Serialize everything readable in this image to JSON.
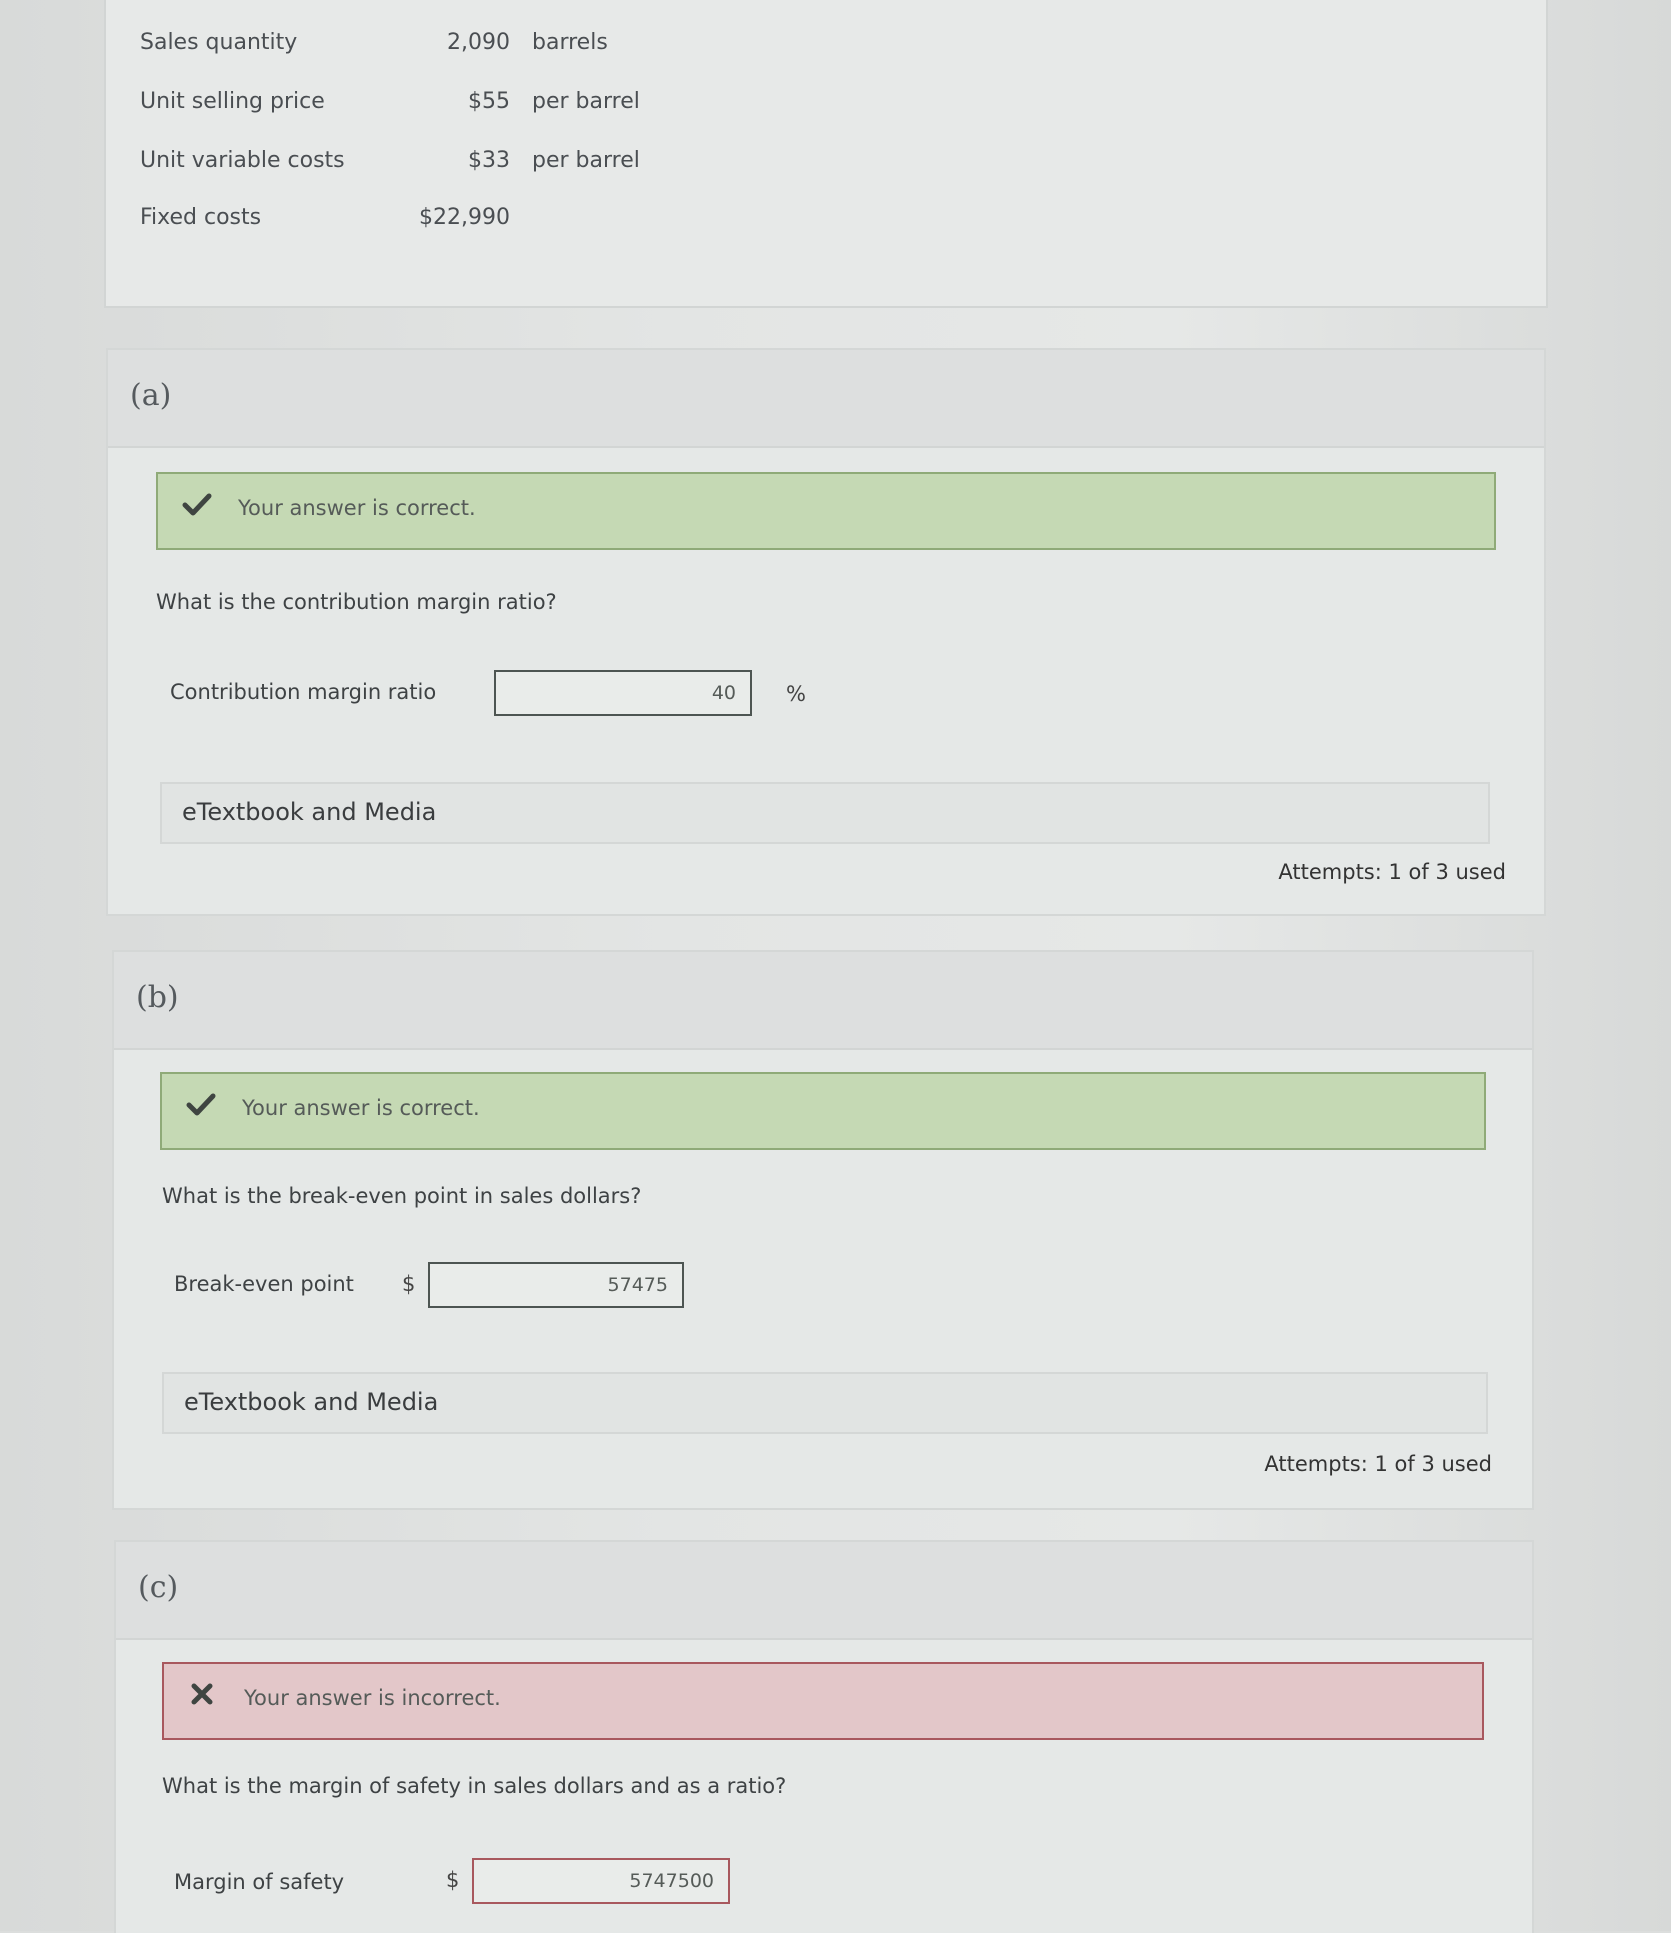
{
  "given": {
    "rows": [
      {
        "label": "Sales quantity",
        "value": "2,090",
        "unit": "barrels"
      },
      {
        "label": "Unit selling price",
        "value": "$55",
        "unit": "per barrel"
      },
      {
        "label": "Unit variable costs",
        "value": "$33",
        "unit": "per barrel"
      },
      {
        "label": "Fixed costs",
        "value": "$22,990",
        "unit": ""
      }
    ]
  },
  "part_a": {
    "letter": "(a)",
    "banner": "Your answer is correct.",
    "question": "What is the contribution margin ratio?",
    "field_label": "Contribution margin ratio",
    "value": "40",
    "suffix": "%",
    "media": "eTextbook and Media",
    "attempts": "Attempts: 1 of 3 used"
  },
  "part_b": {
    "letter": "(b)",
    "banner": "Your answer is correct.",
    "question": "What is the break-even point in sales dollars?",
    "field_label": "Break-even point",
    "currency": "$",
    "value": "57475",
    "media": "eTextbook and Media",
    "attempts": "Attempts: 1 of 3 used"
  },
  "part_c": {
    "letter": "(c)",
    "banner": "Your answer is incorrect.",
    "question": "What is the margin of safety in sales dollars and as a ratio?",
    "field_label": "Margin of safety",
    "currency": "$",
    "value": "5747500"
  },
  "colors": {
    "correct_bg": "#c5d9b4",
    "correct_border": "#8faa78",
    "incorrect_bg": "#e3c7c9",
    "incorrect_border": "#a8585e"
  },
  "icons": {
    "correct": "check-icon",
    "incorrect": "x-icon"
  }
}
